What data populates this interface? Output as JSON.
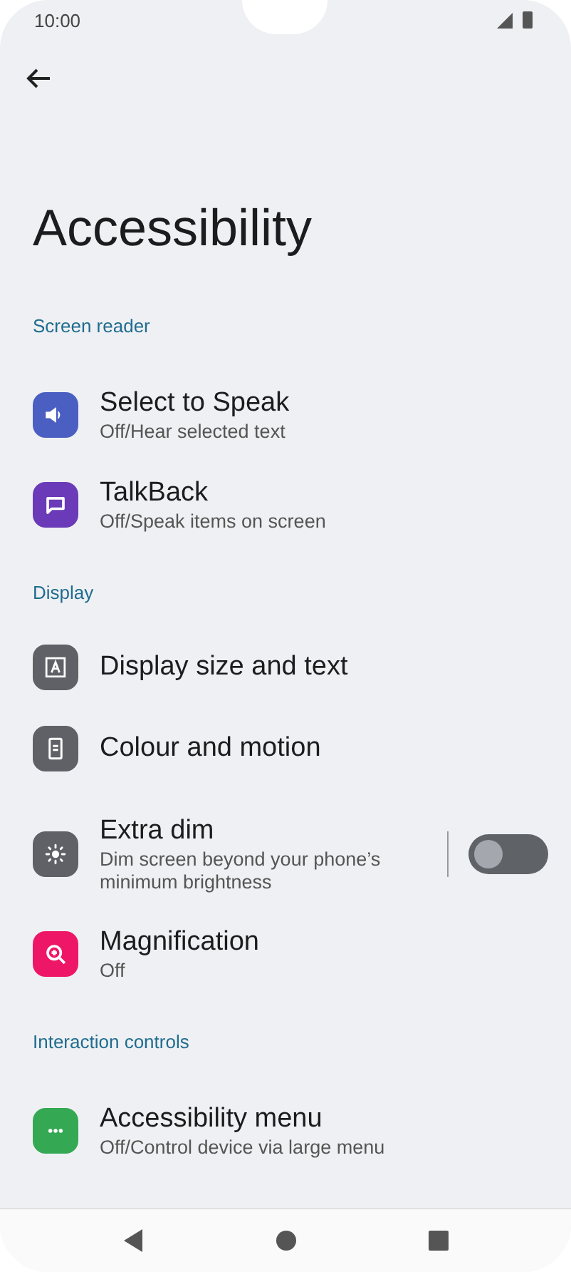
{
  "status_bar": {
    "time": "10:00"
  },
  "title": "Accessibility",
  "sections": [
    {
      "header": "Screen reader",
      "items": [
        {
          "kind": "link",
          "color": "#4a5fc1",
          "title": "Select to Speak",
          "subtitle": "Off/Hear selected text"
        },
        {
          "kind": "link",
          "color": "#6a3ab8",
          "title": "TalkBack",
          "subtitle": "Off/Speak items on screen"
        }
      ]
    },
    {
      "header": "Display",
      "items": [
        {
          "kind": "link",
          "color": "#5f6166",
          "title": "Display size and text"
        },
        {
          "kind": "link",
          "color": "#5f6166",
          "title": "Colour and motion"
        },
        {
          "kind": "switch",
          "color": "#5f6166",
          "title": "Extra dim",
          "subtitle": "Dim screen beyond your phone’s minimum brightness",
          "on": false
        },
        {
          "kind": "link",
          "color": "#ee1666",
          "title": "Magnification",
          "subtitle": "Off"
        }
      ]
    },
    {
      "header": "Interaction controls",
      "items": [
        {
          "kind": "link",
          "color": "#34a853",
          "title": "Accessibility menu",
          "subtitle": "Off/Control device via large menu"
        }
      ]
    }
  ]
}
